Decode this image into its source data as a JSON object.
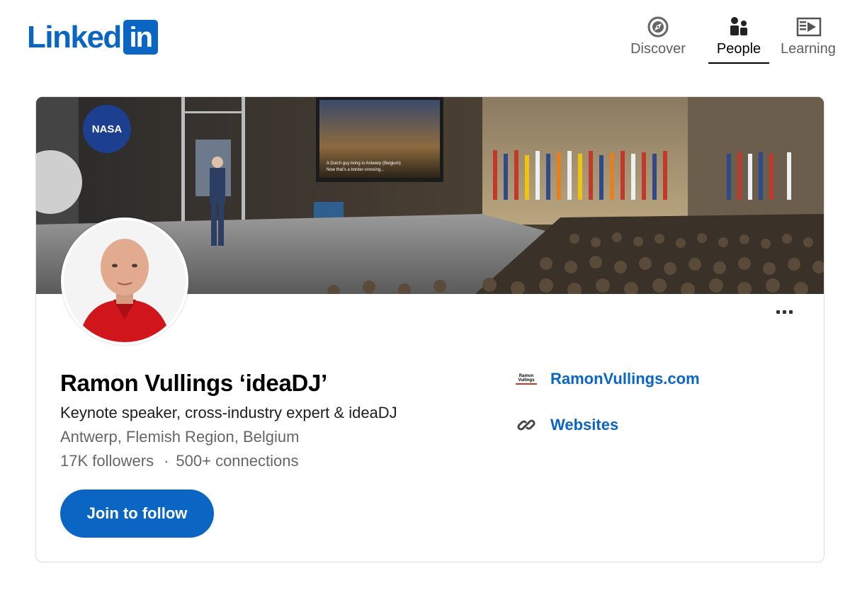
{
  "brand": {
    "logo_text": "Linked",
    "logo_box_text": "in",
    "color": "#0a66c2"
  },
  "nav": [
    {
      "label": "Discover",
      "icon": "compass-icon",
      "active": false
    },
    {
      "label": "People",
      "icon": "people-icon",
      "active": true
    },
    {
      "label": "Learning",
      "icon": "learning-icon",
      "active": false
    }
  ],
  "profile": {
    "name": "Ramon Vullings ‘ideaDJ’",
    "headline": "Keynote speaker, cross-industry expert & ideaDJ",
    "location": "Antwerp, Flemish Region, Belgium",
    "followers": "17K followers",
    "separator": "·",
    "connections": "500+ connections",
    "follow_button": "Join to follow",
    "more_icon": "ellipsis-icon"
  },
  "links": {
    "site_logo_line1": "Ramon",
    "site_logo_line2": "Vullings",
    "site_label": "RamonVullings.com",
    "websites_label": "Websites",
    "websites_icon": "link-icon"
  },
  "cover": {
    "banner_nasa": "NASA",
    "screen_line1": "A Dutch guy living in Antwerp (Belgium)",
    "screen_line2": "Now that's a border-crossing..."
  }
}
